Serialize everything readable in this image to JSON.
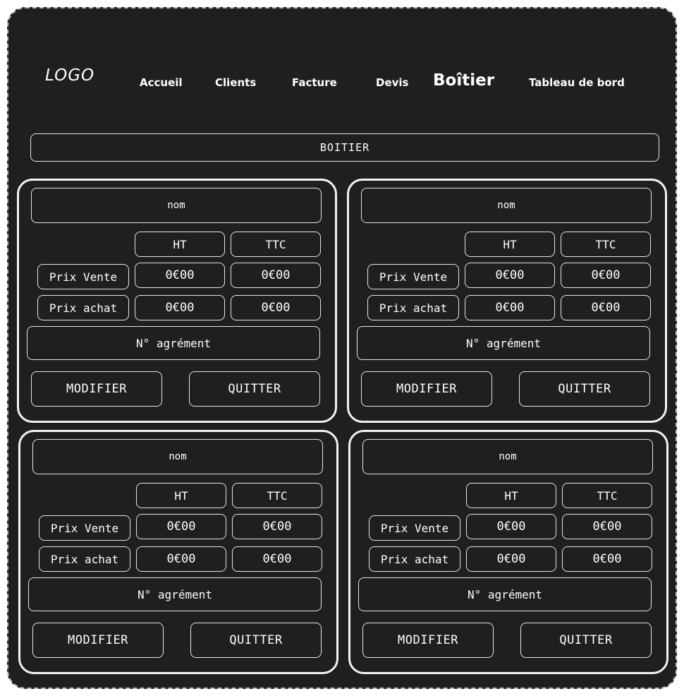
{
  "logo": "LOGO",
  "nav": [
    {
      "label": "Accueil"
    },
    {
      "label": "Clients"
    },
    {
      "label": "Facture"
    },
    {
      "label": "Devis"
    },
    {
      "label": "Boîtier"
    },
    {
      "label": "Tableau de bord"
    }
  ],
  "banner": "BOITIER",
  "cards": [
    {
      "name": "nom",
      "col_ht": "HT",
      "col_ttc": "TTC",
      "row_vente": "Prix Vente",
      "vente_ht": "0€00",
      "vente_ttc": "0€00",
      "row_achat": "Prix achat",
      "achat_ht": "0€00",
      "achat_ttc": "0€00",
      "agrement": "N° agrément",
      "modify": "MODIFIER",
      "quit": "QUITTER"
    },
    {
      "name": "nom",
      "col_ht": "HT",
      "col_ttc": "TTC",
      "row_vente": "Prix Vente",
      "vente_ht": "0€00",
      "vente_ttc": "0€00",
      "row_achat": "Prix achat",
      "achat_ht": "0€00",
      "achat_ttc": "0€00",
      "agrement": "N° agrément",
      "modify": "MODIFIER",
      "quit": "QUITTER"
    },
    {
      "name": "nom",
      "col_ht": "HT",
      "col_ttc": "TTC",
      "row_vente": "Prix Vente",
      "vente_ht": "0€00",
      "vente_ttc": "0€00",
      "row_achat": "Prix achat",
      "achat_ht": "0€00",
      "achat_ttc": "0€00",
      "agrement": "N° agrément",
      "modify": "MODIFIER",
      "quit": "QUITTER"
    },
    {
      "name": "nom",
      "col_ht": "HT",
      "col_ttc": "TTC",
      "row_vente": "Prix Vente",
      "vente_ht": "0€00",
      "vente_ttc": "0€00",
      "row_achat": "Prix achat",
      "achat_ht": "0€00",
      "achat_ttc": "0€00",
      "agrement": "N° agrément",
      "modify": "MODIFIER",
      "quit": "QUITTER"
    }
  ]
}
